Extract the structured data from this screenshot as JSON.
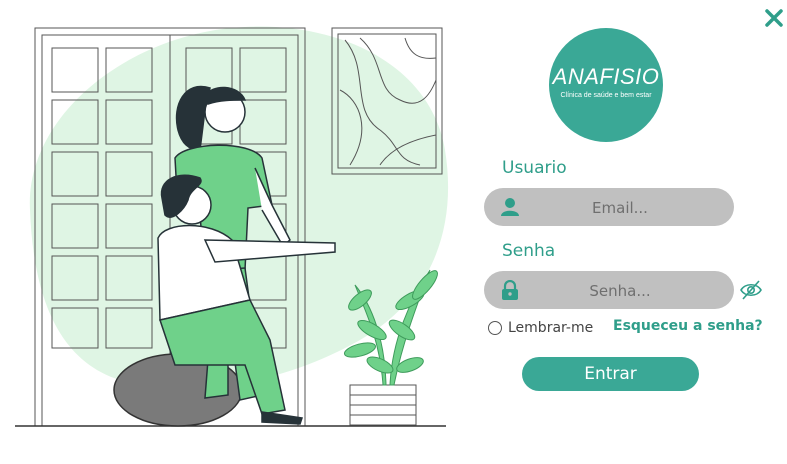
{
  "window": {
    "close_icon": "close-icon"
  },
  "brand": {
    "name": "ANAFISIO",
    "tagline": "Clínica de saúde e bem estar",
    "color": "#3aa896"
  },
  "login": {
    "user_label": "Usuario",
    "email_placeholder": "Email...",
    "password_label": "Senha",
    "password_placeholder": "Senha...",
    "remember_label": "Lembrar-me",
    "forgot_link": "Esqueceu a senha?",
    "submit_label": "Entrar"
  },
  "icons": {
    "user": "user-icon",
    "lock": "lock-icon",
    "eye_off": "eye-off-icon"
  },
  "colors": {
    "accent": "#2f9e8a",
    "input_bg": "#c0c0c0",
    "blob": "#dff5e4"
  }
}
